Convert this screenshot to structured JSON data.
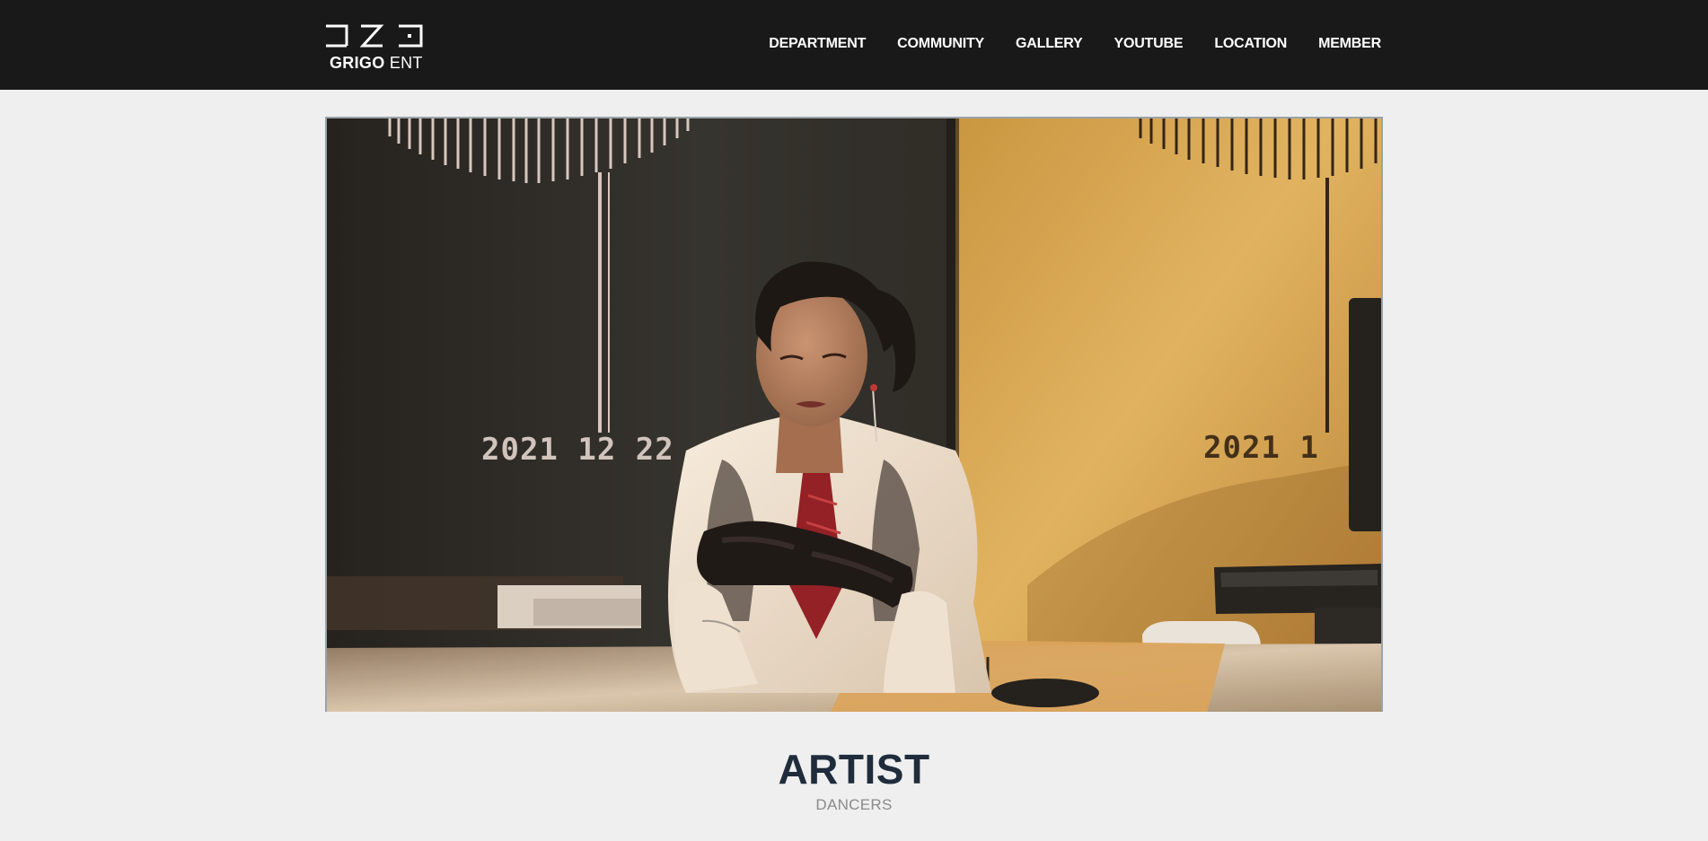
{
  "brand": {
    "name_bold": "GRIGO",
    "name_light": "ENT"
  },
  "nav": {
    "items": [
      {
        "label": "DEPARTMENT"
      },
      {
        "label": "COMMUNITY"
      },
      {
        "label": "GALLERY"
      },
      {
        "label": "YOUTUBE"
      },
      {
        "label": "LOCATION"
      },
      {
        "label": "MEMBER"
      }
    ]
  },
  "hero": {
    "date_left": "2021 12 22",
    "date_right": "2021 1"
  },
  "section": {
    "title": "ARTIST",
    "subtitle": "DANCERS"
  },
  "colors": {
    "header_bg": "#191919",
    "page_bg": "#efefef",
    "title": "#1f2c3c",
    "subtitle": "#8a8a8a"
  }
}
